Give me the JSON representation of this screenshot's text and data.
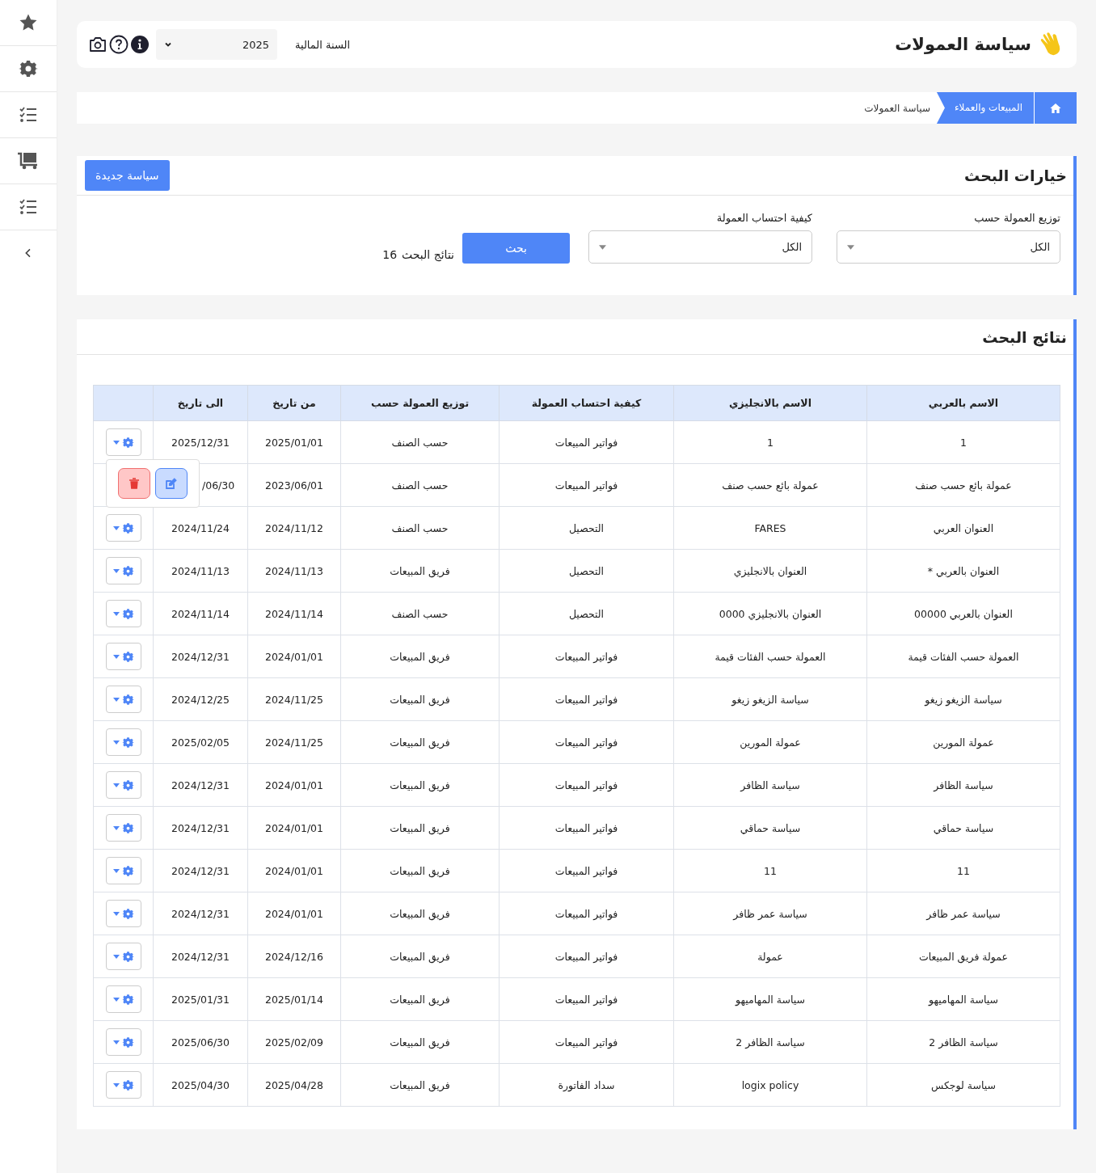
{
  "header": {
    "title": "سياسة العمولات",
    "fiscal_year_label": "السنة المالية",
    "fiscal_year": "2025"
  },
  "breadcrumb": [
    {
      "label": "المبيعات والعملاء",
      "kind": "link"
    },
    {
      "label": "سياسة العمولات",
      "kind": "current"
    }
  ],
  "search_options": {
    "title": "خيارات البحث",
    "new_button": "سياسة جديدة",
    "filters": [
      {
        "label": "توزيع العمولة حسب",
        "value": "الكل"
      },
      {
        "label": "كيفية احتساب العمولة",
        "value": "الكل"
      }
    ],
    "search_button": "بحث",
    "results_label": "نتائج البحث",
    "results_count": "16"
  },
  "results": {
    "title": "نتائج البحث",
    "columns": [
      "الاسم بالعربي",
      "الاسم بالانجليزي",
      "كيفية احتساب العمولة",
      "توزيع العمولة حسب",
      "من تاريخ",
      "الى تاريخ"
    ],
    "rows": [
      {
        "cells": [
          "1",
          "1",
          "فواتير المبيعات",
          "حسب الصنف",
          "2025/01/01",
          "2025/12/31"
        ],
        "menu_open": false
      },
      {
        "cells": [
          "عمولة بائع حسب صنف",
          "عمولة بائع حسب صنف",
          "فواتير المبيعات",
          "حسب الصنف",
          "2023/06/01",
          "/06/30"
        ],
        "menu_open": true
      },
      {
        "cells": [
          "العنوان العربي",
          "FARES",
          "التحصيل",
          "حسب الصنف",
          "2024/11/12",
          "2024/11/24"
        ],
        "menu_open": false
      },
      {
        "cells": [
          "العنوان بالعربي *",
          "العنوان بالانجليزي",
          "التحصيل",
          "فريق المبيعات",
          "2024/11/13",
          "2024/11/13"
        ],
        "menu_open": false
      },
      {
        "cells": [
          "العنوان بالعربي 00000",
          "العنوان بالانجليزي 0000",
          "التحصيل",
          "حسب الصنف",
          "2024/11/14",
          "2024/11/14"
        ],
        "menu_open": false
      },
      {
        "cells": [
          "العمولة حسب الفئات قيمة",
          "العمولة حسب الفئات قيمة",
          "فواتير المبيعات",
          "فريق المبيعات",
          "2024/01/01",
          "2024/12/31"
        ],
        "menu_open": false
      },
      {
        "cells": [
          "سياسة الزيغو زيغو",
          "سياسة الزيغو زيغو",
          "فواتير المبيعات",
          "فريق المبيعات",
          "2024/11/25",
          "2024/12/25"
        ],
        "menu_open": false
      },
      {
        "cells": [
          "عمولة المورين",
          "عمولة المورين",
          "فواتير المبيعات",
          "فريق المبيعات",
          "2024/11/25",
          "2025/02/05"
        ],
        "menu_open": false
      },
      {
        "cells": [
          "سياسة الظافر",
          "سياسة الظافر",
          "فواتير المبيعات",
          "فريق المبيعات",
          "2024/01/01",
          "2024/12/31"
        ],
        "menu_open": false
      },
      {
        "cells": [
          "سياسة حماقي",
          "سياسة حماقي",
          "فواتير المبيعات",
          "فريق المبيعات",
          "2024/01/01",
          "2024/12/31"
        ],
        "menu_open": false
      },
      {
        "cells": [
          "11",
          "11",
          "فواتير المبيعات",
          "فريق المبيعات",
          "2024/01/01",
          "2024/12/31"
        ],
        "menu_open": false
      },
      {
        "cells": [
          "سياسة عمر ظافر",
          "سياسة عمر ظافر",
          "فواتير المبيعات",
          "فريق المبيعات",
          "2024/01/01",
          "2024/12/31"
        ],
        "menu_open": false
      },
      {
        "cells": [
          "عمولة فريق المبيعات",
          "عمولة",
          "فواتير المبيعات",
          "فريق المبيعات",
          "2024/12/16",
          "2024/12/31"
        ],
        "menu_open": false
      },
      {
        "cells": [
          "سياسة المهاميهو",
          "سياسة المهاميهو",
          "فواتير المبيعات",
          "فريق المبيعات",
          "2025/01/14",
          "2025/01/31"
        ],
        "menu_open": false
      },
      {
        "cells": [
          "سياسة الظافر 2",
          "سياسة الظافر 2",
          "فواتير المبيعات",
          "فريق المبيعات",
          "2025/02/09",
          "2025/06/30"
        ],
        "menu_open": false
      },
      {
        "cells": [
          "سياسة لوجكس",
          "logix policy",
          "سداد الفاتورة",
          "فريق المبيعات",
          "2025/04/28",
          "2025/04/30"
        ],
        "menu_open": false
      }
    ]
  }
}
